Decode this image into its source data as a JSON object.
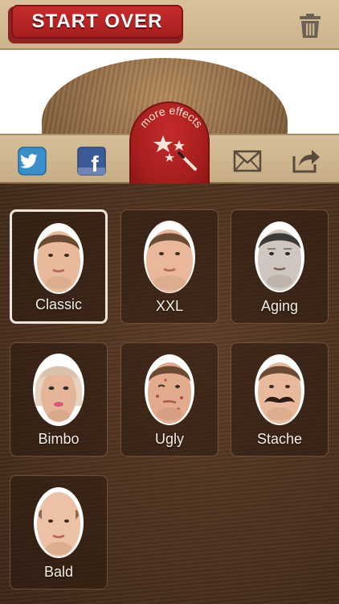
{
  "header": {
    "start_over_label": "START OVER",
    "trash_icon": "trash-icon"
  },
  "sharebar": {
    "twitter_icon": "twitter-icon",
    "facebook_icon": "facebook-icon",
    "more_effects_label": "more effects",
    "more_effects_icon": "magic-wand-icon",
    "mail_icon": "mail-icon",
    "share_icon": "share-export-icon"
  },
  "effects": [
    {
      "label": "Classic",
      "selected": true
    },
    {
      "label": "XXL",
      "selected": false
    },
    {
      "label": "Aging",
      "selected": false
    },
    {
      "label": "Bimbo",
      "selected": false
    },
    {
      "label": "Ugly",
      "selected": false
    },
    {
      "label": "Stache",
      "selected": false
    },
    {
      "label": "Bald",
      "selected": false
    }
  ],
  "colors": {
    "accent_red": "#c62a2a",
    "wood_light": "#d6bf99",
    "wood_dark": "#4a2f1d",
    "selected_border": "#ece4d8"
  }
}
